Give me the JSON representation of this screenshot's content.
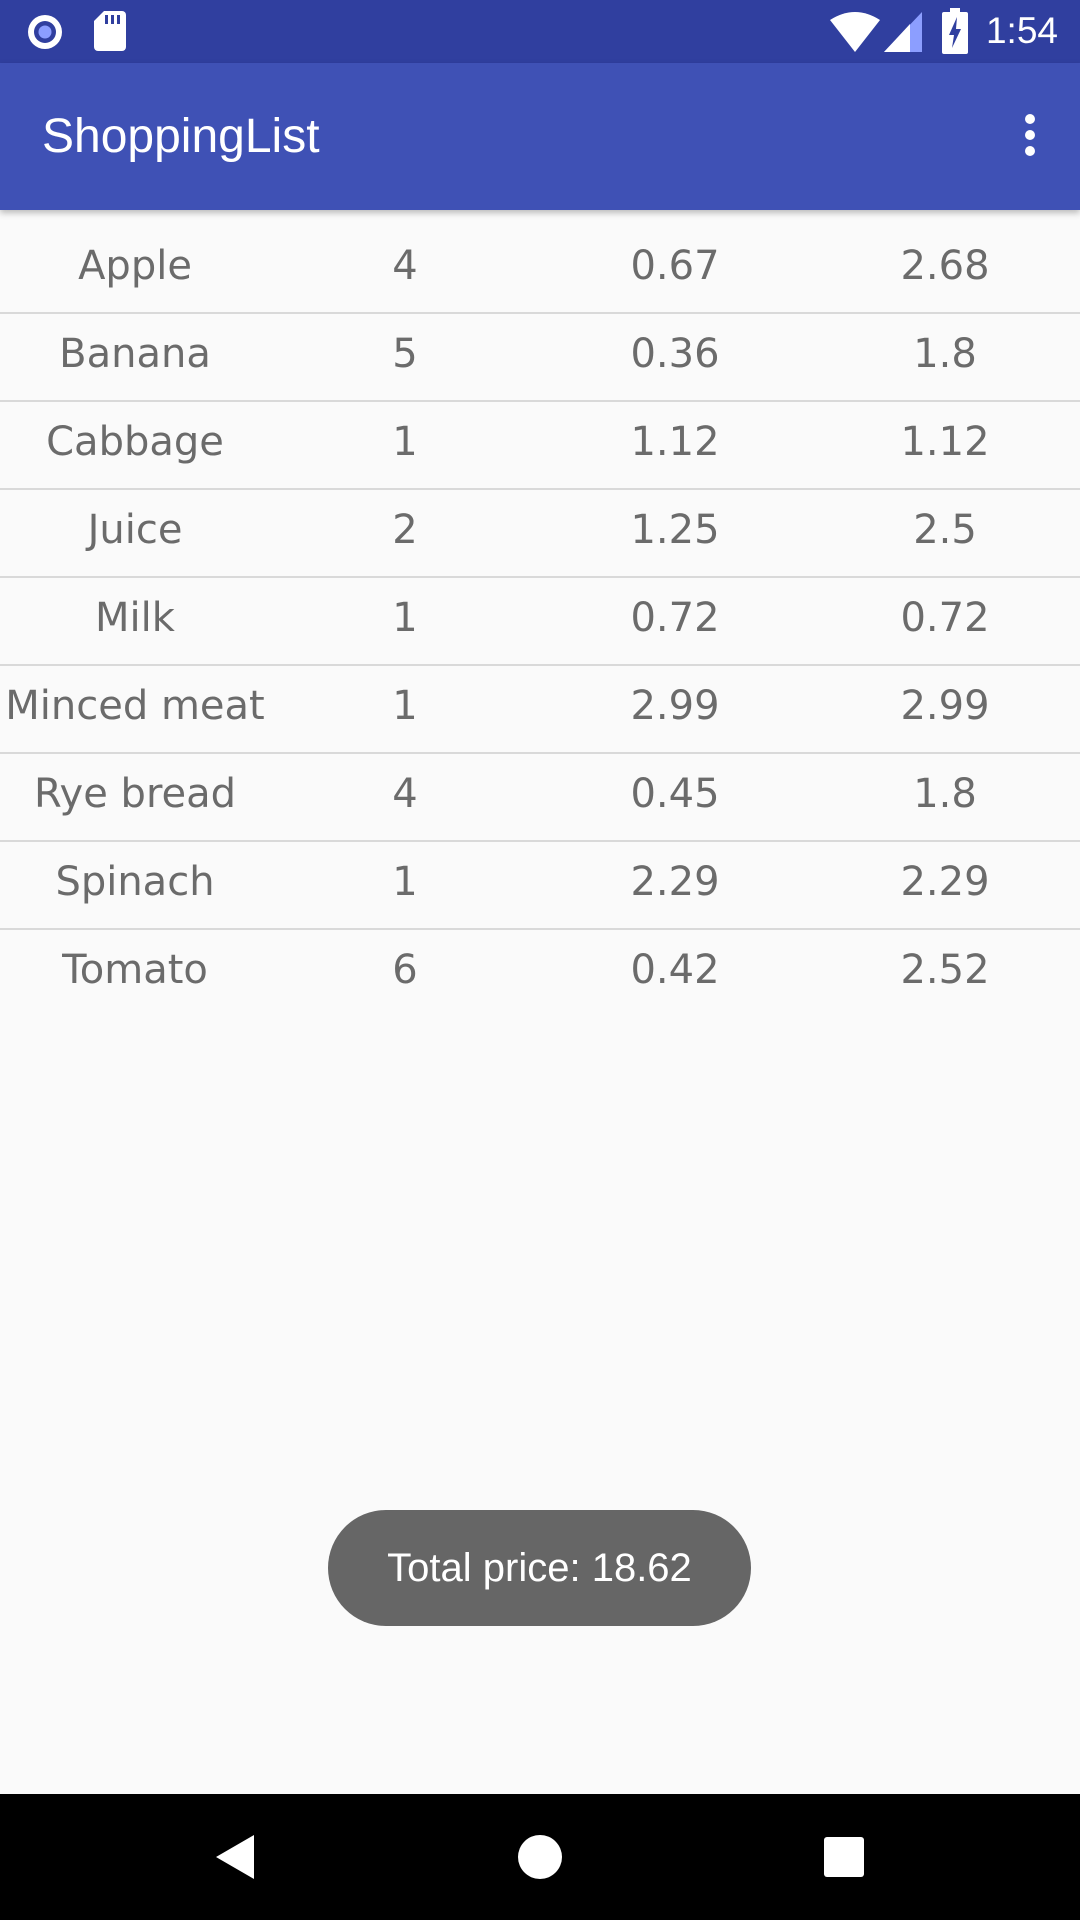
{
  "status_bar": {
    "time": "1:54",
    "icons": [
      "circle-icon",
      "sd-card-icon",
      "wifi-icon",
      "cellular-icon",
      "battery-charging-icon"
    ]
  },
  "app_bar": {
    "title": "ShoppingList",
    "menu_icon": "more-vert-icon"
  },
  "items": [
    {
      "name": "Apple",
      "quantity": "4",
      "unit_price": "0.67",
      "total": "2.68"
    },
    {
      "name": "Banana",
      "quantity": "5",
      "unit_price": "0.36",
      "total": "1.8"
    },
    {
      "name": "Cabbage",
      "quantity": "1",
      "unit_price": "1.12",
      "total": "1.12"
    },
    {
      "name": "Juice",
      "quantity": "2",
      "unit_price": "1.25",
      "total": "2.5"
    },
    {
      "name": "Milk",
      "quantity": "1",
      "unit_price": "0.72",
      "total": "0.72"
    },
    {
      "name": "Minced meat",
      "quantity": "1",
      "unit_price": "2.99",
      "total": "2.99"
    },
    {
      "name": "Rye bread",
      "quantity": "4",
      "unit_price": "0.45",
      "total": "1.8"
    },
    {
      "name": "Spinach",
      "quantity": "1",
      "unit_price": "2.29",
      "total": "2.29"
    },
    {
      "name": "Tomato",
      "quantity": "6",
      "unit_price": "0.42",
      "total": "2.52"
    }
  ],
  "toast": {
    "text": "Total price: 18.62"
  },
  "nav_bar": {
    "buttons": [
      "back-icon",
      "home-icon",
      "recents-icon"
    ]
  },
  "colors": {
    "status_bar": "#303f9f",
    "app_bar": "#3f51b5",
    "background": "#fafafa",
    "toast": "#666666"
  }
}
